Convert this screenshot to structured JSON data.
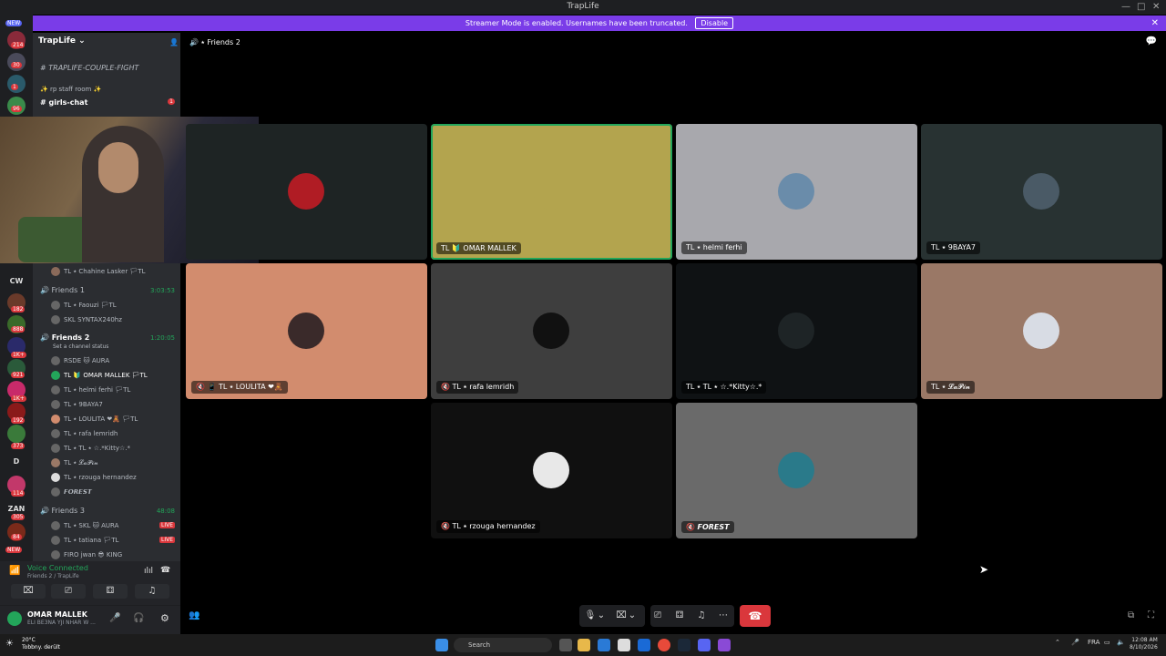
{
  "window": {
    "title": "TrapLife",
    "minimize": "—",
    "maximize": "□",
    "close": "✕"
  },
  "banner": {
    "text": "Streamer Mode is enabled. Usernames have been truncated.",
    "disable_label": "Disable",
    "close": "✕"
  },
  "servers": {
    "new_top": "NEW",
    "badges": [
      "214",
      "30",
      "1",
      "96",
      "182",
      "888",
      "1K+",
      "921",
      "1K+",
      "192",
      "373",
      "114",
      "305",
      "84"
    ],
    "text_items": [
      "CW",
      "D",
      "ZAN"
    ],
    "new_bottom": "NEW"
  },
  "channel_sidebar": {
    "server_name": "TrapLife",
    "channels": [
      {
        "name": "TRAPLIFE-COUPLE-FIGHT"
      },
      {
        "name": "✨ rp staff room ✨"
      },
      {
        "name": "girls-chat",
        "badge": "1"
      }
    ],
    "partial_user": "TL ⭑ Chahine Lasker 🏳TL",
    "friends1": {
      "name": "Friends 1",
      "time": "3:03:53",
      "users": [
        "TL ⭑ Faouzi 🏳TL",
        "SKL SYNTAX240hz"
      ]
    },
    "friends2": {
      "name": "Friends 2",
      "time": "1:20:05",
      "status": "Set a channel status",
      "users": [
        "𝖱𝖲𝖣𝖤 🐱 AURA",
        "TL 🔰 OMAR MALLEK 🏳TL",
        "TL ⭑ helmi ferhi 🏳TL",
        "TL ⭑ 9BAYA7",
        "TL ⭑ LOULITA ❤🧸 🏳TL",
        "TL ⭑ rafa lemridh",
        "TL ⭑ TL ⭑ ☆.*Kitty☆.*",
        "TL ⭑ 𝓛𝓪𝓟𝓲𝓷",
        "TL ⭑ rzouga hernandez",
        "𝙁𝙊𝙍𝙀𝙎𝙏"
      ]
    },
    "friends3": {
      "name": "Friends 3",
      "time": "48:08",
      "users": [
        "TL ⭑ SKL 🐱 AURA",
        "TL ⭑ tatiana 🏳TL",
        "FIRO jwan 😎 KING"
      ],
      "live_label": "LIVE"
    }
  },
  "voice_panel": {
    "status": "Voice Connected",
    "location": "Friends 2 / TrapLife"
  },
  "user_panel": {
    "name": "OMAR MALLEK",
    "status": "ELI BE3NA YJI NHAR W ..."
  },
  "main_header": {
    "channel": "Friends 2"
  },
  "tiles": [
    {
      "label": "",
      "bg": "#1e2424",
      "avatar_color": "#b01c24"
    },
    {
      "label": "TL 🔰 OMAR MALLEK",
      "bg": "#b3a44e",
      "avatar_color": "#b3a44e",
      "speaking": true
    },
    {
      "label": "TL ⭑ helmi ferhi",
      "bg": "#a8a8ad",
      "avatar_color": "#6a8caa"
    },
    {
      "label": "TL ⭑ 9BAYA7",
      "bg": "#283232",
      "avatar_color": "#4a5a66"
    },
    {
      "label": "🔇 📱 TL ⭑ LOULITA ❤🧸",
      "bg": "#d28c6e",
      "avatar_color": "#3a2a2a"
    },
    {
      "label": "🔇 TL ⭑ rafa lemridh",
      "bg": "#3e3e3e",
      "avatar_color": "#111111"
    },
    {
      "label": "TL ⭑ TL ⭑ ☆.*Kitty☆.*",
      "bg": "#0f1214",
      "avatar_color": "#1e2426"
    },
    {
      "label": "TL ⭑ 𝓛𝓪𝓟𝓲𝓷",
      "bg": "#9a7866",
      "avatar_color": "#d8dce4"
    },
    {
      "label": "🔇 TL ⭑ rzouga hernandez",
      "bg": "#101010",
      "avatar_color": "#e8e8e8"
    },
    {
      "label": "🔇 𝙁𝙊𝙍𝙀𝙎𝙏",
      "bg": "#6a6a6a",
      "avatar_color": "#2a7a8a"
    }
  ],
  "taskbar": {
    "temperature": "20°C",
    "weather": "Tobbny. derült",
    "search": "Search",
    "lang": "FRA",
    "time": "12:08 AM",
    "date": "8/10/2026"
  }
}
